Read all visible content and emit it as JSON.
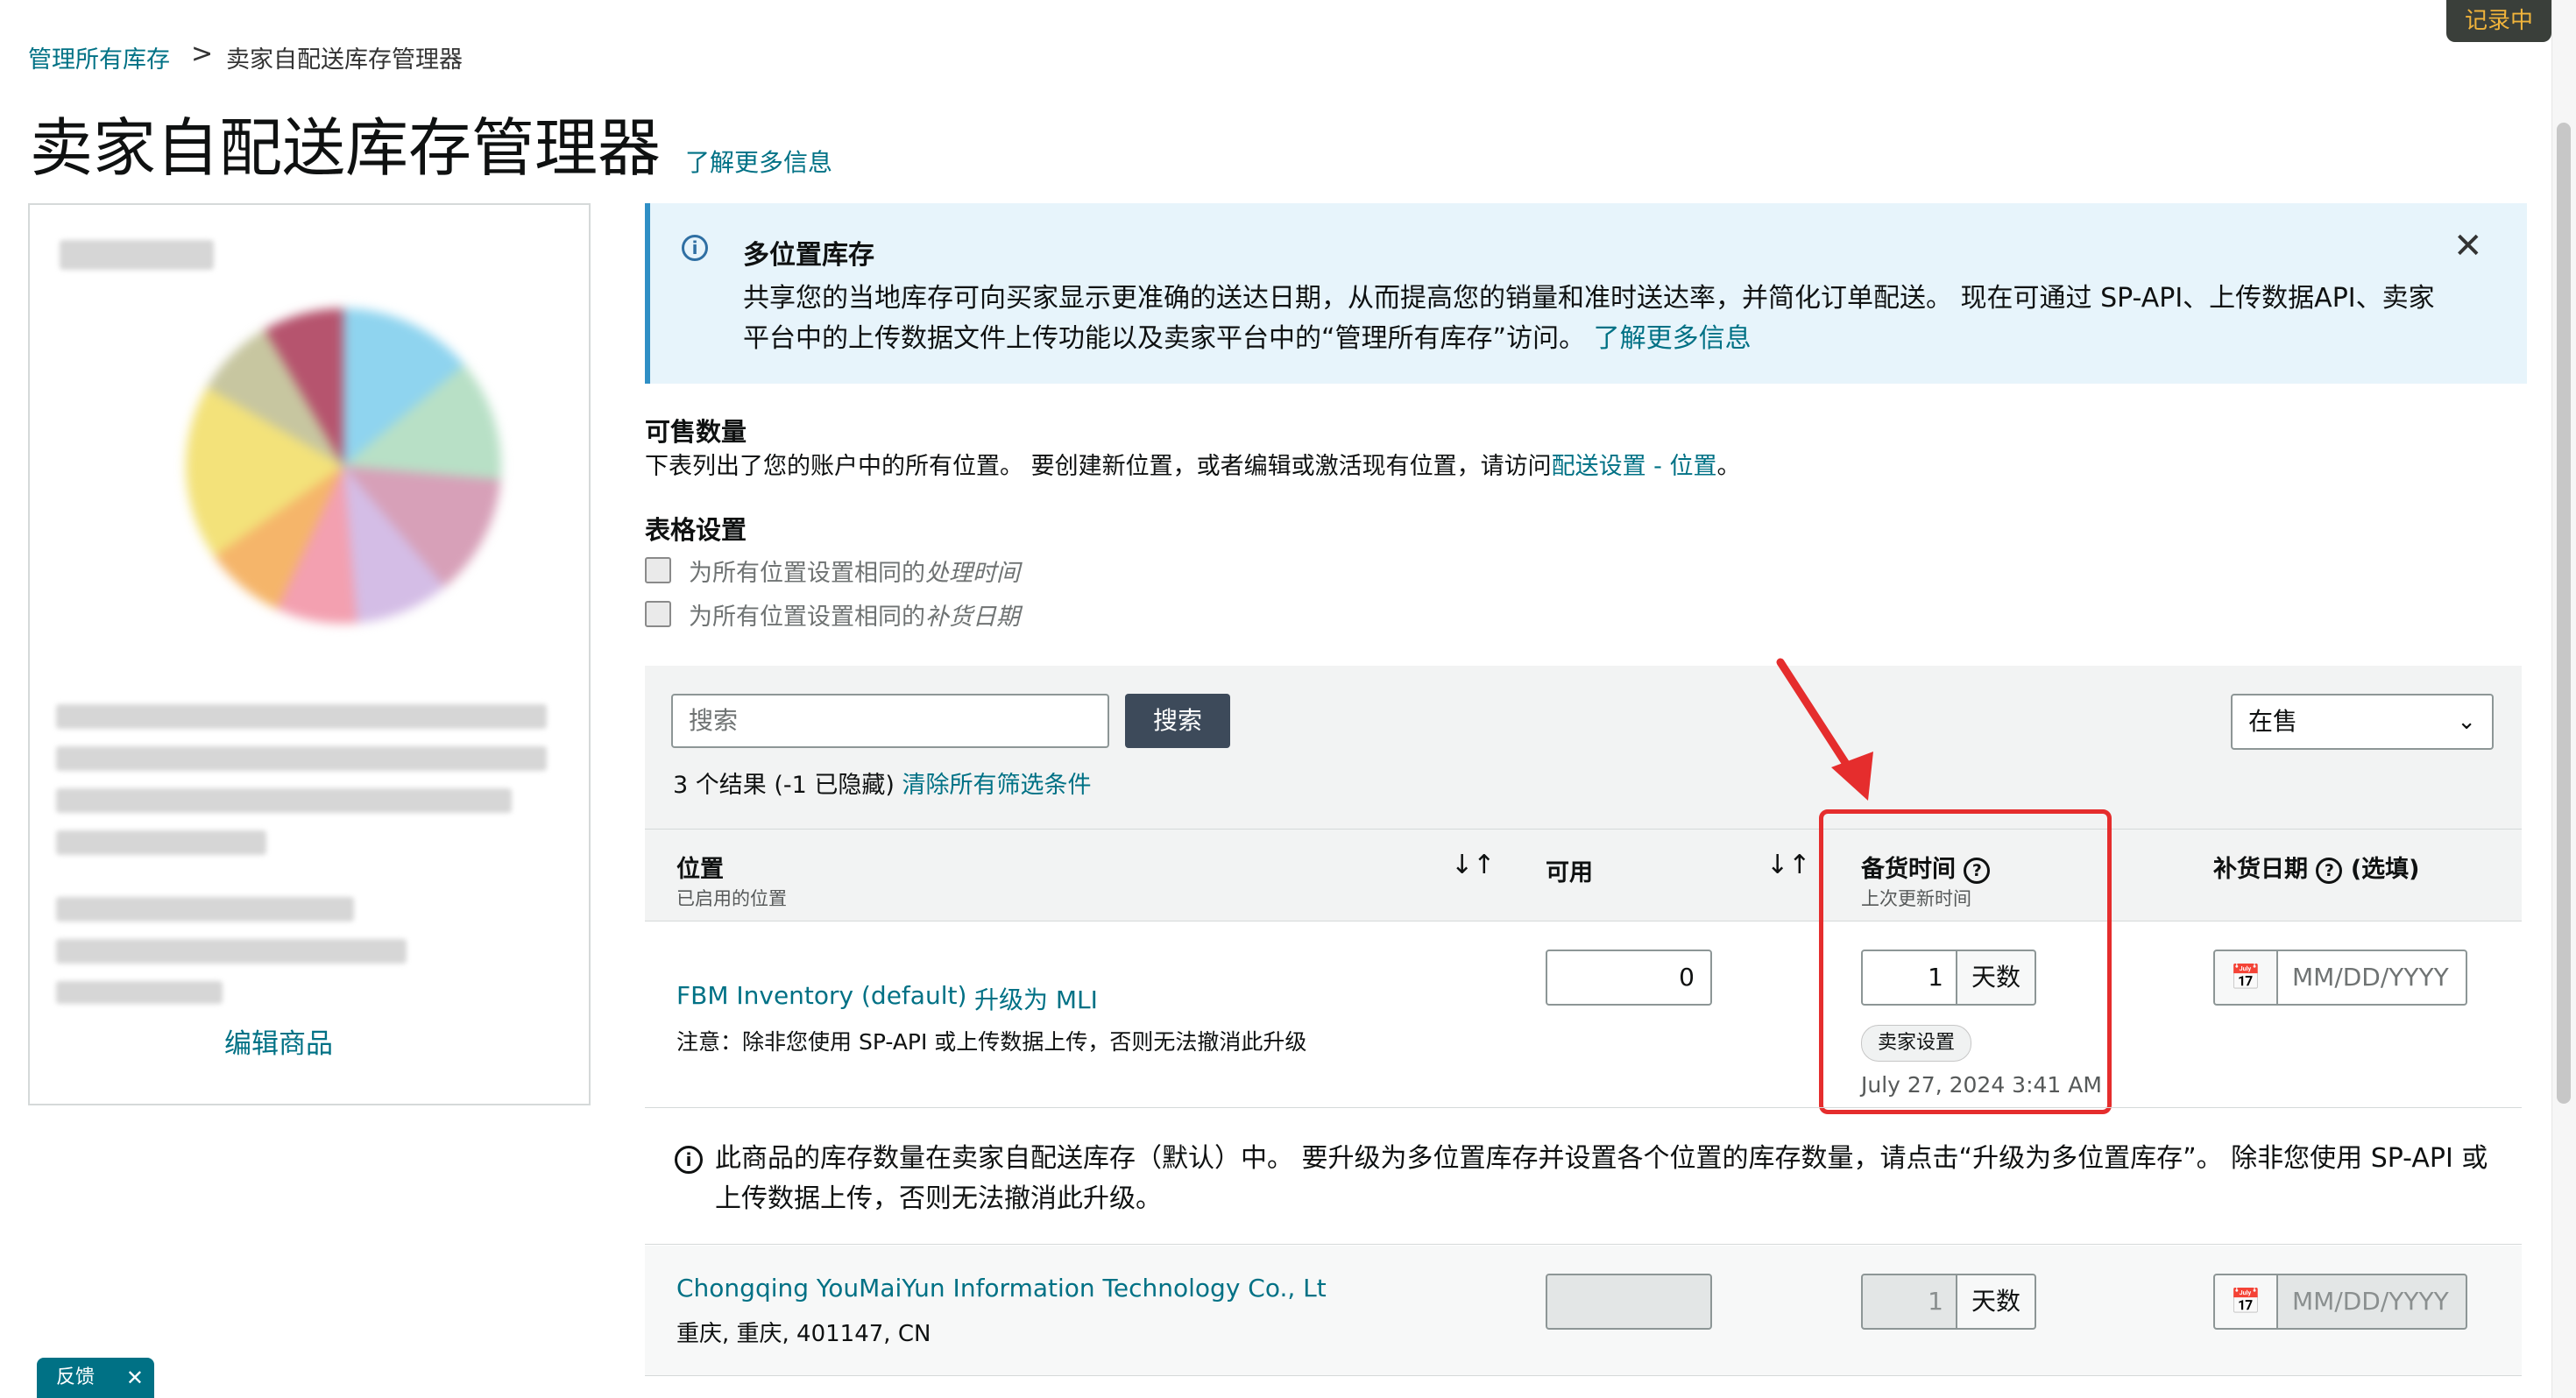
{
  "recording_tag": "记录中",
  "breadcrumb": {
    "parent": "管理所有库存",
    "separator": ">",
    "current": "卖家自配送库存管理器"
  },
  "page": {
    "title": "卖家自配送库存管理器",
    "learn_more": "了解更多信息"
  },
  "product_card": {
    "edit_label": "编辑商品"
  },
  "banner": {
    "title": "多位置库存",
    "text": "共享您的当地库存可向买家显示更准确的送达日期，从而提高您的销量和准时送达率，并简化订单配送。 现在可通过 SP-API、上传数据API、卖家平台中的上传数据文件上传功能以及卖家平台中的“管理所有库存”访问。",
    "link": "了解更多信息",
    "close": "✕"
  },
  "sellable": {
    "title": "可售数量",
    "desc_prefix": "下表列出了您的账户中的所有位置。 要创建新位置，或者编辑或激活现有位置，请访问",
    "desc_link": "配送设置 - 位置",
    "desc_suffix": "。"
  },
  "table_settings": {
    "title": "表格设置",
    "opt1_prefix": "为所有位置设置相同的",
    "opt1_em": "处理时间",
    "opt2_prefix": "为所有位置设置相同的",
    "opt2_em": "补货日期"
  },
  "filter": {
    "search_placeholder": "搜索",
    "search_button": "搜索",
    "results_text": "3 个结果 (-1 已隐藏)",
    "clear_filters": "清除所有筛选条件",
    "status_select": "在售"
  },
  "table": {
    "headers": {
      "location": "位置",
      "location_sub": "已启用的位置",
      "available": "可用",
      "handling": "备货时间",
      "handling_sub": "上次更新时间",
      "restock": "补货日期",
      "restock_optional": "(选填)",
      "help": "?",
      "sort": "↓↑"
    },
    "rows": [
      {
        "location": "FBM Inventory (default)",
        "upgrade": "升级为 MLI",
        "note": "注意：除非您使用 SP-API 或上传数据上传，否则无法撤消此升级",
        "available": "0",
        "handling_days": "1",
        "days_unit": "天数",
        "badge": "卖家设置",
        "updated": "July 27, 2024 3:41 AM",
        "date_placeholder": "MM/DD/YYYY"
      },
      {
        "location": "Chongqing YouMaiYun Information Technology Co., Lt",
        "address": "重庆, 重庆, 401147, CN",
        "available": "",
        "handling_days": "1",
        "days_unit": "天数",
        "date_placeholder": "MM/DD/YYYY"
      }
    ],
    "notice": "此商品的库存数量在卖家自配送库存（默认）中。 要升级为多位置库存并设置各个位置的库存数量，请点击“升级为多位置库存”。 除非您使用 SP-API 或上传数据上传，否则无法撤消此升级。"
  },
  "feedback": {
    "label": "反馈",
    "close": "✕"
  },
  "colors": {
    "link": "#007185",
    "annotation": "#e52d2d",
    "banner_bg": "#e7f4fb",
    "button_dark": "#3d4a5a"
  }
}
